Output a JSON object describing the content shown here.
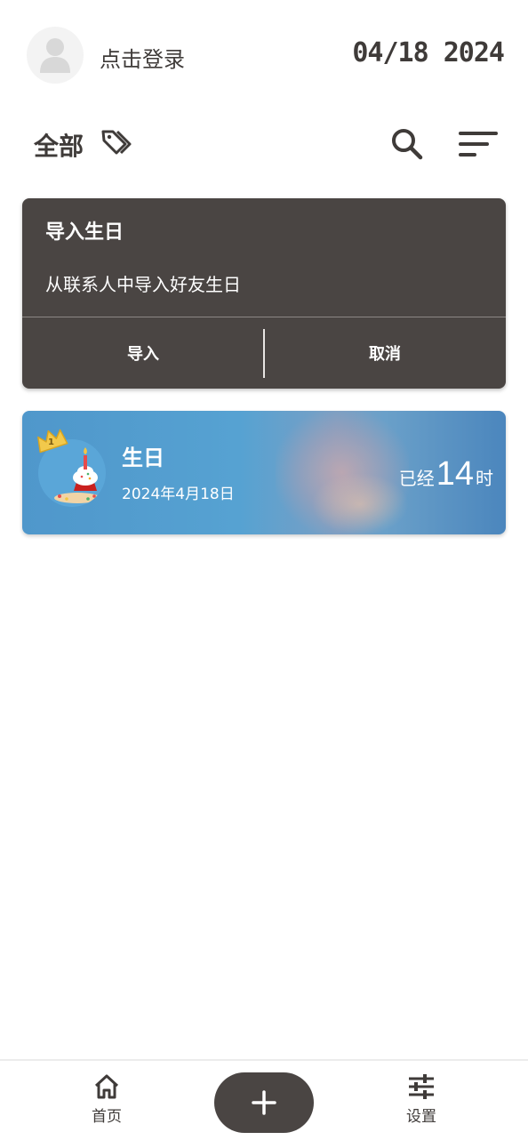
{
  "header": {
    "avatar_icon": "user-avatar-icon",
    "login_label": "点击登录",
    "date": "04/18 2024"
  },
  "filter": {
    "category_label": "全部",
    "tag_icon": "tags-icon",
    "search_icon": "search-icon",
    "sort_icon": "sort-icon"
  },
  "import_dialog": {
    "title": "导入生日",
    "description": "从联系人中导入好友生日",
    "import_label": "导入",
    "cancel_label": "取消",
    "background": "#4a4543"
  },
  "birthday_card": {
    "rank_badge": "1",
    "title": "生日",
    "date": "2024年4月18日",
    "elapsed_prefix": "已经",
    "elapsed_value": "14",
    "elapsed_unit": "时",
    "accent": "#4f97cb"
  },
  "bottom_nav": {
    "home_label": "首页",
    "settings_label": "设置",
    "home_icon": "home-icon",
    "add_icon": "plus-icon",
    "settings_icon": "sliders-icon"
  }
}
